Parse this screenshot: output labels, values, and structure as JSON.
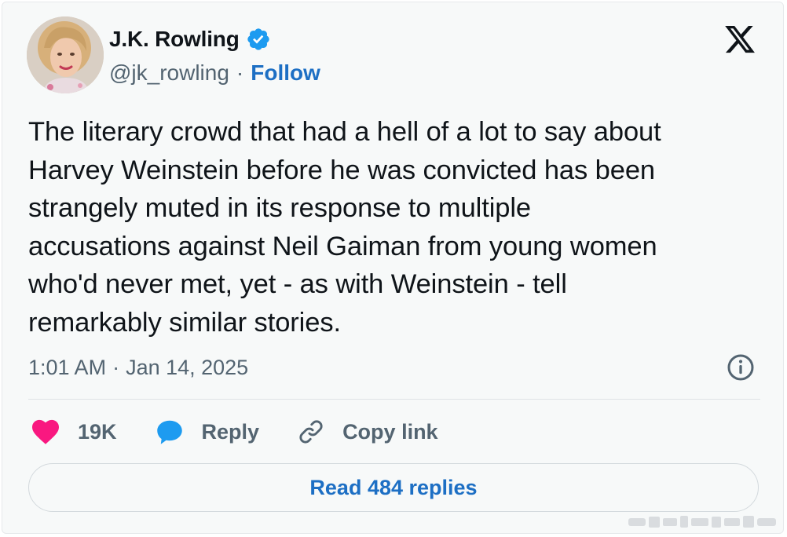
{
  "author": {
    "name": "J.K. Rowling",
    "handle": "@jk_rowling",
    "separator": "·",
    "follow_label": "Follow"
  },
  "tweet": {
    "lines": [
      "The literary crowd that had a hell of a lot to say about",
      "Harvey Weinstein before he was convicted has been",
      "strangely muted in its response to multiple",
      "accusations against Neil Gaiman from young women",
      "who'd never met, yet - as with Weinstein - tell",
      "remarkably similar stories."
    ],
    "time": "1:01 AM",
    "separator": "·",
    "date": "Jan 14, 2025"
  },
  "actions": {
    "like_count": "19K",
    "reply_label": "Reply",
    "copy_link_label": "Copy link"
  },
  "read_replies_label": "Read 484 replies",
  "icons": {
    "verified": "verified-badge-icon",
    "brand": "x-logo-icon",
    "info": "info-icon",
    "like": "heart-icon",
    "reply": "speech-bubble-icon",
    "copy": "link-icon"
  },
  "colors": {
    "accent": "#1d6fc4",
    "verified": "#1d9bf0",
    "heart": "#f91880",
    "reply_bubble": "#1d9bf0",
    "text": "#0f1419",
    "muted": "#536471",
    "card_bg": "#f7f9f9"
  }
}
